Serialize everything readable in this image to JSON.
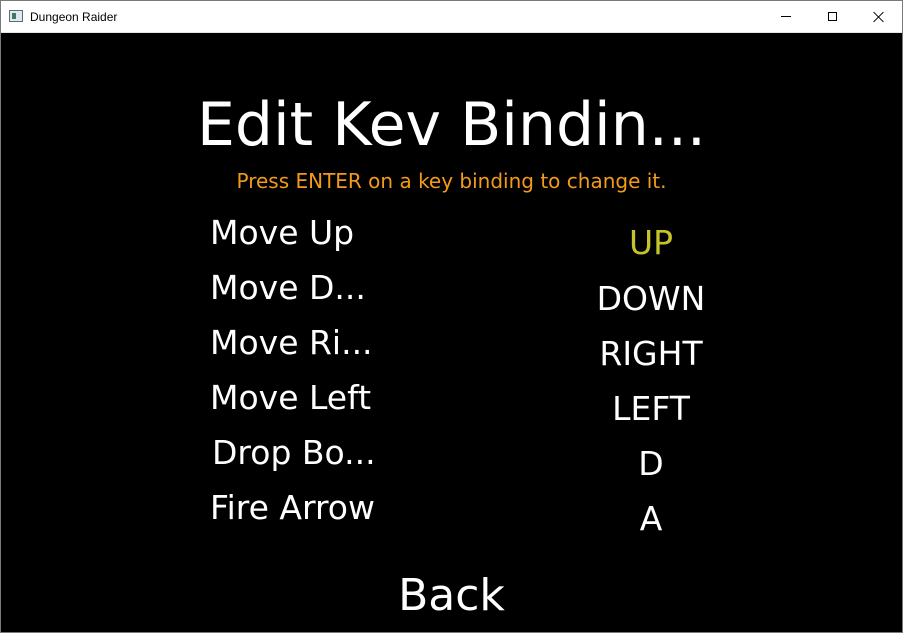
{
  "window": {
    "title": "Dungeon Raider",
    "icon": "app-window-icon",
    "controls": {
      "minimize_icon": "minimize-icon",
      "maximize_icon": "maximize-icon",
      "close_icon": "close-icon"
    }
  },
  "screen": {
    "title": "Edit Kev Bindin...",
    "hint": "Press ENTER on a key binding to change it.",
    "hint_color": "#f29a1c",
    "selected_color": "#c7c42a",
    "background_color": "#000000",
    "bindings": [
      {
        "action": "Move Up",
        "key": "UP",
        "selected": true
      },
      {
        "action": "Move D...",
        "key": "DOWN",
        "selected": false
      },
      {
        "action": "Move Ri...",
        "key": "RIGHT",
        "selected": false
      },
      {
        "action": "Move Left",
        "key": "LEFT",
        "selected": false
      },
      {
        "action": "Drop Bo...",
        "key": "D",
        "selected": false
      },
      {
        "action": "Fire Arrow",
        "key": "A",
        "selected": false
      }
    ],
    "back_label": "Back"
  }
}
